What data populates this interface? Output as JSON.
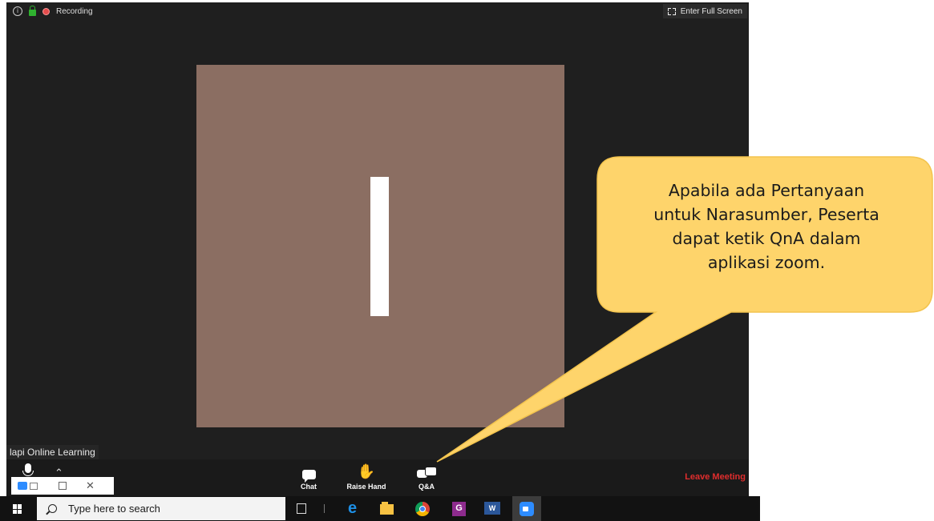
{
  "meeting": {
    "recording_label": "Recording",
    "fullscreen_label": "Enter Full Screen",
    "participant_name": "lapi Online Learning"
  },
  "toolbar": {
    "chat_label": "Chat",
    "raise_hand_label": "Raise Hand",
    "qa_label": "Q&A",
    "leave_label": "Leave Meeting"
  },
  "taskbar": {
    "search_placeholder": "Type here to search",
    "apps": [
      "task-view",
      "edge",
      "file-explorer",
      "chrome",
      "pdf-app",
      "word",
      "zoom"
    ]
  },
  "callout": {
    "lines": [
      "Apabila ada Pertanyaan",
      "untuk Narasumber,  Peserta",
      "dapat ketik QnA dalam",
      "aplikasi zoom."
    ],
    "fill_color": "#fed46b",
    "border_color": "#f3c44e"
  },
  "colors": {
    "meeting_bg": "#1f1f1f",
    "video_tile": "#8b6e62",
    "leave_red": "#e02d2d",
    "zoom_blue": "#2d8cff"
  }
}
